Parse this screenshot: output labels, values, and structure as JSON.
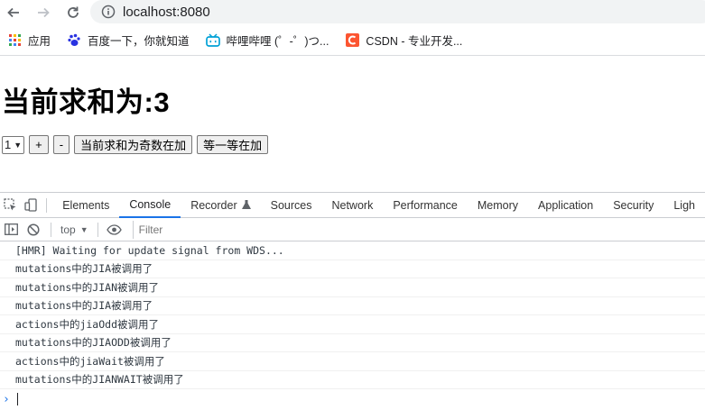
{
  "browser": {
    "url": "localhost:8080",
    "bookmarks": [
      {
        "label": "应用",
        "icon": "apps-grid-icon"
      },
      {
        "label": "百度一下，你就知道",
        "icon": "baidu-paw-icon"
      },
      {
        "label": "哔哩哔哩 (゜-゜)つ...",
        "icon": "bilibili-tv-icon"
      },
      {
        "label": "CSDN - 专业开发...",
        "icon": "csdn-logo-icon"
      }
    ]
  },
  "page": {
    "sum_text": "当前求和为:3",
    "select_value": "1",
    "buttons": {
      "plus": "+",
      "minus": "-",
      "odd_add": "当前求和为奇数在加",
      "wait_add": "等一等在加"
    }
  },
  "devtools": {
    "tabs": [
      "Elements",
      "Console",
      "Recorder",
      "Sources",
      "Network",
      "Performance",
      "Memory",
      "Application",
      "Security",
      "Ligh"
    ],
    "active_tab": "Console",
    "context": "top",
    "filter_placeholder": "Filter",
    "console_lines": [
      "[HMR] Waiting for update signal from WDS...",
      "mutations中的JIA被调用了",
      "mutations中的JIAN被调用了",
      "mutations中的JIA被调用了",
      "actions中的jiaOdd被调用了",
      "mutations中的JIAODD被调用了",
      "actions中的jiaWait被调用了",
      "mutations中的JIANWAIT被调用了"
    ],
    "prompt_symbol": "›"
  },
  "colors": {
    "accent": "#1a73e8",
    "omnibox_bg": "#f1f3f4",
    "baidu": "#2932e1",
    "bilibili": "#00a1d6",
    "csdn": "#fc5531"
  }
}
